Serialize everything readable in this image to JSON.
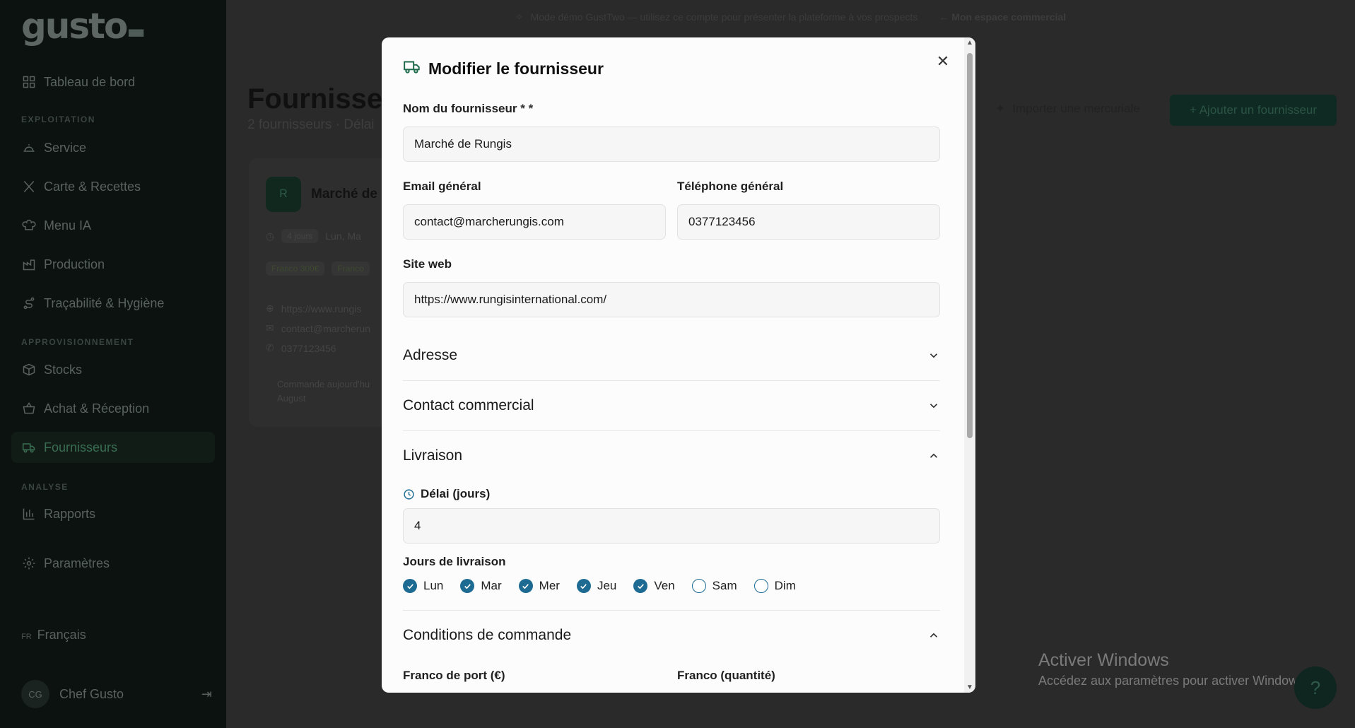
{
  "sidebar": {
    "logo": "gusto",
    "items": [
      {
        "label": "Tableau de bord"
      },
      {
        "label": "Service"
      },
      {
        "label": "Carte & Recettes"
      },
      {
        "label": "Menu IA"
      },
      {
        "label": "Production"
      },
      {
        "label": "Traçabilité & Hygiène"
      },
      {
        "label": "Stocks"
      },
      {
        "label": "Achat & Réception"
      },
      {
        "label": "Fournisseurs"
      },
      {
        "label": "Rapports"
      },
      {
        "label": "Paramètres"
      }
    ],
    "sections": [
      "EXPLOITATION",
      "APPROVISIONNEMENT",
      "ANALYSE"
    ],
    "lang_code": "FR",
    "lang_label": "Français",
    "user_initials": "CG",
    "user_name": "Chef Gusto"
  },
  "banner": {
    "text": "Mode démo GustTwo — utilisez ce compte pour présenter la plateforme à vos prospects",
    "link": "← Mon espace commercial"
  },
  "page": {
    "title": "Fournisse",
    "subtitle": "2 fournisseurs · Délai",
    "import_button": "Importer une mercuriale",
    "add_button": "+ Ajouter un fournisseur"
  },
  "card": {
    "initial": "R",
    "name": "Marché de",
    "delay": "4 jours",
    "days_preview": "Lun, Ma",
    "pill1": "Franco 300€",
    "pill2": "Franco",
    "website": "https://www.rungis",
    "email": "contact@marcherun",
    "phone": "0377123456",
    "note_line1": "Commande aujourd'hu",
    "note_line2": "August"
  },
  "modal": {
    "title": "Modifier le fournisseur",
    "fields": {
      "name_label": "Nom du fournisseur",
      "name_req": " * *",
      "name_value": "Marché de Rungis",
      "email_label": "Email général",
      "email_value": "contact@marcherungis.com",
      "phone_label": "Téléphone général",
      "phone_value": "0377123456",
      "web_label": "Site web",
      "web_value": "https://www.rungisinternational.com/"
    },
    "sections": {
      "address": "Adresse",
      "contact": "Contact commercial",
      "delivery": "Livraison",
      "conditions": "Conditions de commande"
    },
    "delivery": {
      "delay_label": "Délai (jours)",
      "delay_value": "4",
      "days_label": "Jours de livraison",
      "days": [
        {
          "label": "Lun",
          "checked": true
        },
        {
          "label": "Mar",
          "checked": true
        },
        {
          "label": "Mer",
          "checked": true
        },
        {
          "label": "Jeu",
          "checked": true
        },
        {
          "label": "Ven",
          "checked": true
        },
        {
          "label": "Sam",
          "checked": false
        },
        {
          "label": "Dim",
          "checked": false
        }
      ]
    },
    "conditions": {
      "franco_port_label": "Franco de port (€)",
      "franco_qty_label": "Franco (quantité)"
    },
    "accent_color": "#1d6a92",
    "brand_color": "#1c6a4a"
  },
  "watermark": {
    "title": "Activer Windows",
    "subtitle": "Accédez aux paramètres pour activer Windows."
  }
}
